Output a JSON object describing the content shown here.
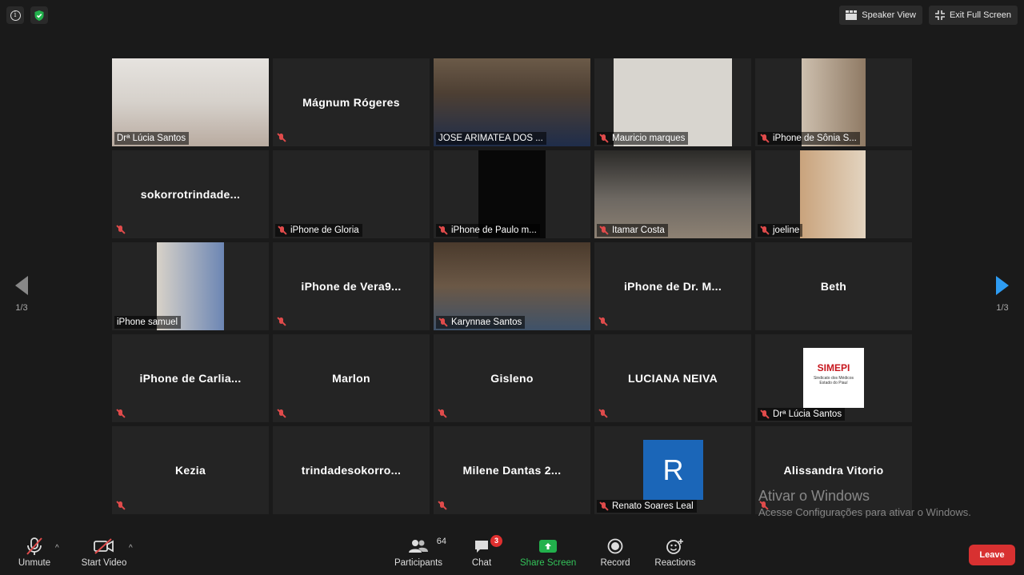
{
  "top": {
    "speaker_view": "Speaker View",
    "exit_full_screen": "Exit Full Screen"
  },
  "nav": {
    "left_page": "1/3",
    "right_page": "1/3"
  },
  "tiles": [
    {
      "type": "video",
      "label": "Drª Lúcia Santos",
      "muted": false
    },
    {
      "type": "name",
      "name": "Mágnum Rógeres",
      "muted": true
    },
    {
      "type": "video",
      "label": "JOSE ARIMATEA DOS ...",
      "muted": false
    },
    {
      "type": "video",
      "label": "Mauricio marques",
      "muted": true
    },
    {
      "type": "video",
      "label": "iPhone de Sônia S...",
      "muted": true
    },
    {
      "type": "name",
      "name": "sokorrotrindade...",
      "muted": true
    },
    {
      "type": "black",
      "label": "iPhone de Gloria",
      "muted": true
    },
    {
      "type": "video",
      "label": "iPhone de Paulo m...",
      "muted": true
    },
    {
      "type": "video",
      "label": "Itamar Costa",
      "muted": true
    },
    {
      "type": "video",
      "label": "joeline",
      "muted": true
    },
    {
      "type": "video",
      "label": "iPhone samuel",
      "muted": false,
      "active": true
    },
    {
      "type": "name",
      "name": "iPhone de Vera9...",
      "muted": true
    },
    {
      "type": "video",
      "label": "Karynnae Santos",
      "muted": true
    },
    {
      "type": "name",
      "name": "iPhone de Dr. M...",
      "muted": true
    },
    {
      "type": "name",
      "name": "Beth",
      "muted": false
    },
    {
      "type": "name",
      "name": "iPhone de Carlia...",
      "muted": true
    },
    {
      "type": "name",
      "name": "Marlon",
      "muted": true
    },
    {
      "type": "name",
      "name": "Gisleno",
      "muted": true
    },
    {
      "type": "name",
      "name": "LUCIANA NEIVA",
      "muted": true
    },
    {
      "type": "logo",
      "label": "Drª Lúcia Santos",
      "muted": true,
      "logo_text": "SIMEPI",
      "logo_sub": "Sindicato dos Médicos Estado do Piauí"
    },
    {
      "type": "name",
      "name": "Kezia",
      "muted": true
    },
    {
      "type": "name",
      "name": "trindadesokorro...",
      "muted": false
    },
    {
      "type": "name",
      "name": "Milene Dantas 2...",
      "muted": true
    },
    {
      "type": "avatar",
      "label": "Renato Soares Leal",
      "muted": true,
      "avatar_letter": "R"
    },
    {
      "type": "name",
      "name": "Alissandra Vitorio",
      "muted": true
    }
  ],
  "watermark": {
    "line1": "Ativar o Windows",
    "line2": "Acesse Configurações para ativar o Windows."
  },
  "toolbar": {
    "unmute": "Unmute",
    "start_video": "Start Video",
    "participants": "Participants",
    "participants_count": "64",
    "chat": "Chat",
    "chat_badge": "3",
    "share_screen": "Share Screen",
    "record": "Record",
    "reactions": "Reactions",
    "leave": "Leave"
  }
}
